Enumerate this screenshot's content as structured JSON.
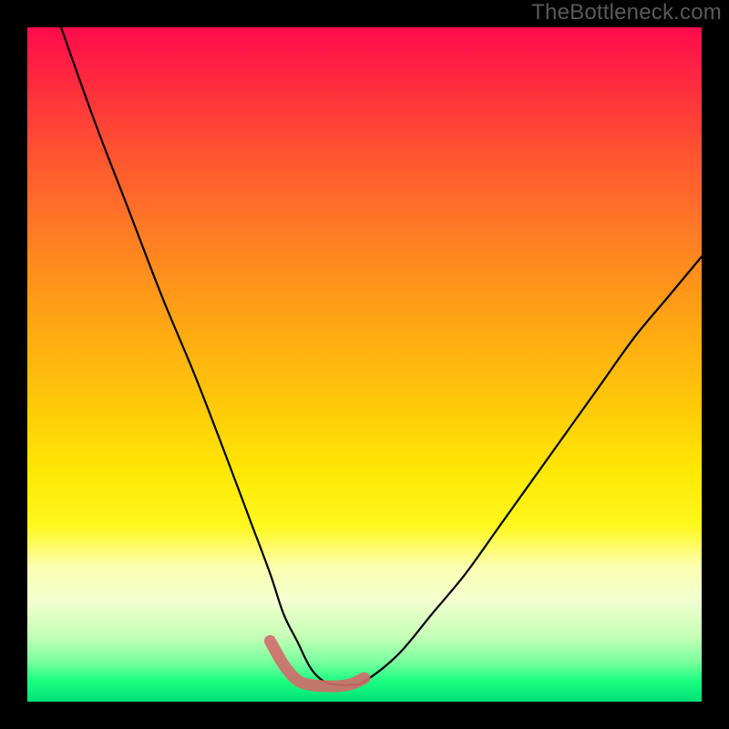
{
  "watermark": "TheBottleneck.com",
  "chart_data": {
    "type": "line",
    "title": "",
    "xlabel": "",
    "ylabel": "",
    "xlim": [
      0,
      100
    ],
    "ylim": [
      0,
      100
    ],
    "grid": false,
    "legend": false,
    "series": [
      {
        "name": "curve",
        "color": "#000000",
        "x": [
          5,
          10,
          15,
          20,
          25,
          30,
          33,
          36,
          38,
          40,
          42,
          44,
          46,
          48,
          50,
          55,
          60,
          65,
          70,
          75,
          80,
          85,
          90,
          95,
          100
        ],
        "values": [
          100,
          86,
          73,
          60,
          48,
          35,
          27,
          19,
          13,
          9,
          5,
          3,
          2.5,
          2.5,
          3,
          7,
          13,
          19,
          26,
          33,
          40,
          47,
          54,
          60,
          66
        ]
      },
      {
        "name": "trough-marker",
        "color": "#d36a6a",
        "x": [
          36,
          38,
          40,
          42,
          44,
          46,
          48,
          50
        ],
        "values": [
          9,
          5.5,
          3.2,
          2.5,
          2.3,
          2.3,
          2.6,
          3.5
        ]
      }
    ]
  }
}
